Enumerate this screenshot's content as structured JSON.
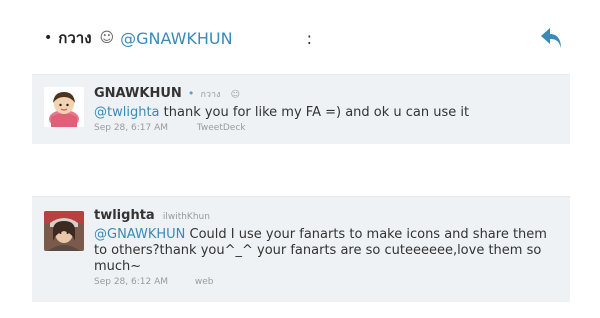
{
  "header": {
    "bullet": "•",
    "thai_name": "กวาง",
    "smiley": "☺",
    "handle": "@GNAWKHUN",
    "colon": ":",
    "reply_icon": "reply-arrow-icon",
    "accent_color": "#3a8ab8"
  },
  "tweets": [
    {
      "author": "GNAWKHUN",
      "separator": "•",
      "subname": "กวาง",
      "smiley": "☺",
      "mention": "@twlighta",
      "text": " thank you for like my FA =) and ok u can use it",
      "timestamp": "Sep 28, 6:17 AM",
      "source": "TweetDeck",
      "avatar_icon": "cartoon-avatar-icon"
    },
    {
      "author": "twlighta",
      "subname": "ilwithKhun",
      "mention": "@GNAWKHUN",
      "text": " Could I use your fanarts to make icons and share them to others?thank you^_^ your fanarts are so cuteeeeee,love them so much~",
      "timestamp": "Sep 28, 6:12 AM",
      "source": "web",
      "avatar_icon": "photo-avatar-icon"
    }
  ],
  "colors": {
    "tweet_bg": "#eef2f5",
    "link": "#3a8ab8",
    "meta": "#9a9a9a"
  }
}
